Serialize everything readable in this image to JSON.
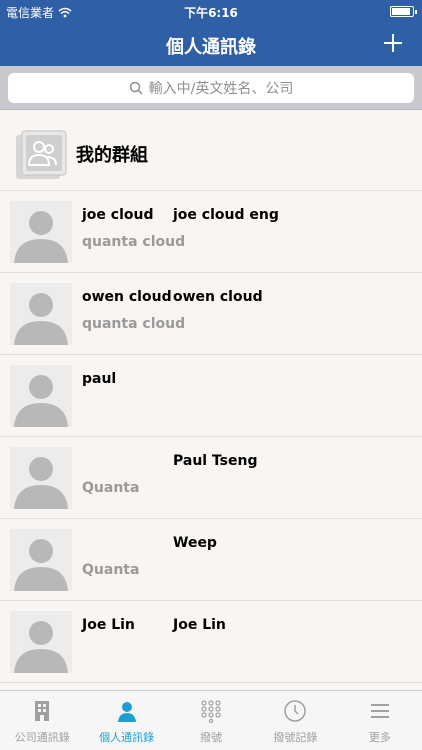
{
  "status": {
    "carrier": "電信業者",
    "time": "下午6:16"
  },
  "nav": {
    "title": "個人通訊錄"
  },
  "search": {
    "placeholder": "輸入中/英文姓名、公司"
  },
  "group": {
    "label": "我的群組"
  },
  "contacts": [
    {
      "name1": "joe cloud",
      "name2": "joe cloud eng",
      "company": "quanta cloud"
    },
    {
      "name1": "owen cloud",
      "name2": "owen cloud",
      "company": "quanta cloud"
    },
    {
      "name1": "paul",
      "name2": "",
      "company": ""
    },
    {
      "name1": "",
      "name2": "Paul Tseng",
      "company": "Quanta"
    },
    {
      "name1": "",
      "name2": "Weep",
      "company": "Quanta"
    },
    {
      "name1": "Joe Lin",
      "name2": "Joe Lin",
      "company": ""
    }
  ],
  "tabs": [
    {
      "label": "公司通訊錄",
      "icon": "building-icon"
    },
    {
      "label": "個人通訊錄",
      "icon": "person-icon"
    },
    {
      "label": "撥號",
      "icon": "keypad-icon"
    },
    {
      "label": "撥號記錄",
      "icon": "clock-icon"
    },
    {
      "label": "更多",
      "icon": "menu-icon"
    }
  ],
  "colors": {
    "header": "#2f5fa6",
    "active_tab": "#1f9fd0"
  }
}
